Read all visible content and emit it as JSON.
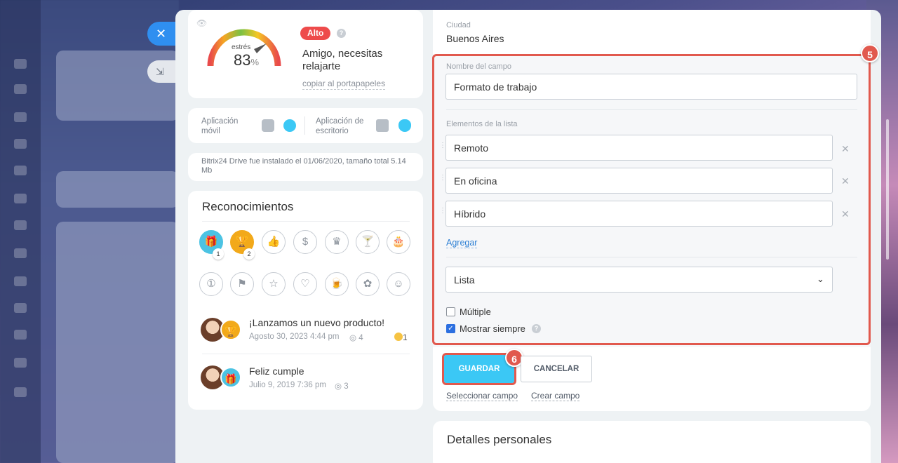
{
  "stress": {
    "label": "estrés",
    "value": "83",
    "unit": "%",
    "level_badge": "Alto",
    "message": "Amigo, necesitas relajarte",
    "copy_link": "copiar al portapapeles"
  },
  "apps": {
    "mobile_label": "Aplicación móvil",
    "desktop_label": "Aplicación de escritorio"
  },
  "drive": {
    "text": "Bitrix24 Drive fue instalado el 01/06/2020, tamaño total 5.14 Mb"
  },
  "recognitions": {
    "title": "Reconocimientos",
    "badges": [
      {
        "icon": "gift-icon",
        "count": "1"
      },
      {
        "icon": "trophy-icon",
        "count": "2"
      }
    ],
    "feed": [
      {
        "title": "¡Lanzamos un nuevo producto!",
        "meta": "Agosto 30, 2023 4:44 pm",
        "views": "4",
        "reactions": "1"
      },
      {
        "title": "Feliz cumple",
        "meta": "Julio 9, 2019 7:36 pm",
        "views": "3"
      }
    ]
  },
  "form": {
    "city_label": "Ciudad",
    "city_value": "Buenos Aires",
    "field_name_label": "Nombre del campo",
    "field_name_value": "Formato de trabajo",
    "list_items_label": "Elementos de la lista",
    "list_items": [
      "Remoto",
      "En oficina",
      "Híbrido"
    ],
    "add_link": "Agregar",
    "type_select": "Lista",
    "multiple_label": "Múltiple",
    "show_always_label": "Mostrar siempre",
    "save_button": "GUARDAR",
    "cancel_button": "CANCELAR",
    "select_field_link": "Seleccionar campo",
    "create_field_link": "Crear campo",
    "step_fields": "5",
    "step_save": "6"
  },
  "personal": {
    "title": "Detalles personales"
  },
  "colors": {
    "accent": "#3bc8f5",
    "highlight": "#e1594e",
    "badge_red": "#ee4b4b"
  }
}
